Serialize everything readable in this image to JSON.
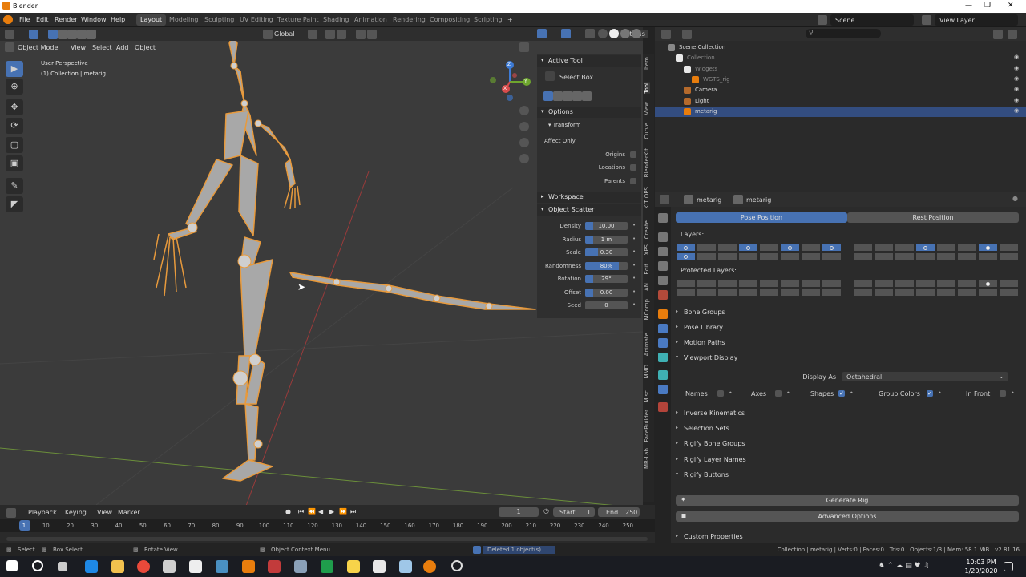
{
  "app": {
    "title": "Blender"
  },
  "menus": [
    "File",
    "Edit",
    "Render",
    "Window",
    "Help"
  ],
  "workspaces": [
    "Layout",
    "Modeling",
    "Sculpting",
    "UV Editing",
    "Texture Paint",
    "Shading",
    "Animation",
    "Rendering",
    "Compositing",
    "Scripting"
  ],
  "active_workspace": "Layout",
  "scene": {
    "name": "Scene",
    "view_layer": "View Layer"
  },
  "viewport": {
    "transform_orientation": "Global",
    "options_label": "Options",
    "mode": "Object Mode",
    "menu": [
      "View",
      "Select",
      "Add",
      "Object"
    ],
    "overlay_line1": "User Perspective",
    "overlay_line2": "(1) Collection | metarig",
    "gizmo_axes": [
      "Z",
      "Y",
      "X"
    ]
  },
  "npanel": {
    "active_tool_header": "Active Tool",
    "active_tool": "Select Box",
    "options_header": "Options",
    "transform_header": "Transform",
    "affect_only": "Affect Only",
    "origins": "Origins",
    "locations": "Locations",
    "parents": "Parents",
    "workspace_header": "Workspace",
    "scatter_header": "Object Scatter",
    "scatter": [
      {
        "label": "Density",
        "value": "10.00",
        "fill": 0.18
      },
      {
        "label": "Radius",
        "value": "1 m",
        "fill": 0.18
      },
      {
        "label": "Scale",
        "value": "0.30",
        "fill": 0.3
      },
      {
        "label": "Randomness",
        "value": "80%",
        "fill": 0.8
      },
      {
        "label": "Rotation",
        "value": "29°",
        "fill": 0.18
      },
      {
        "label": "Offset",
        "value": "0.00",
        "fill": 0.18
      },
      {
        "label": "Seed",
        "value": "0",
        "fill": 0
      }
    ],
    "vertical_tabs": [
      "Item",
      "Tool",
      "View",
      "Curve",
      "BlenderKit",
      "KIT OPS",
      "Create",
      "XPS",
      "Edit",
      "AN",
      "MComp",
      "Animate",
      "MMD",
      "Misc",
      "FaceBuilder",
      "MB-Lab"
    ]
  },
  "outliner": {
    "rows": [
      {
        "label": "Scene Collection",
        "indent": 0
      },
      {
        "label": "Collection",
        "indent": 1
      },
      {
        "label": "Widgets",
        "indent": 2
      },
      {
        "label": "WGTS_rig",
        "indent": 3
      },
      {
        "label": "Camera",
        "indent": 2
      },
      {
        "label": "Light",
        "indent": 2
      },
      {
        "label": "metarig",
        "indent": 2
      }
    ]
  },
  "properties": {
    "breadcrumb1": "metarig",
    "breadcrumb2": "metarig",
    "pose_position": "Pose Position",
    "rest_position": "Rest Position",
    "layers_label": "Layers:",
    "protected_label": "Protected Layers:",
    "sections": [
      "Bone Groups",
      "Pose Library",
      "Motion Paths",
      "Viewport Display",
      "Inverse Kinematics",
      "Selection Sets",
      "Rigify Bone Groups",
      "Rigify Layer Names",
      "Rigify Buttons",
      "Custom Properties"
    ],
    "display_as_label": "Display As",
    "display_as_value": "Octahedral",
    "display_checks": [
      {
        "label": "Names",
        "checked": false
      },
      {
        "label": "Axes",
        "checked": false
      },
      {
        "label": "Shapes",
        "checked": true
      },
      {
        "label": "Group Colors",
        "checked": true
      },
      {
        "label": "In Front",
        "checked": false
      }
    ],
    "generate_rig": "Generate Rig",
    "advanced_options": "Advanced Options"
  },
  "timeline": {
    "menu": [
      "Playback",
      "Keying",
      "View",
      "Marker"
    ],
    "current_frame": "1",
    "start_label": "Start",
    "start": "1",
    "end_label": "End",
    "end": "250",
    "ticks": [
      "1",
      "10",
      "20",
      "30",
      "40",
      "50",
      "60",
      "70",
      "80",
      "90",
      "100",
      "110",
      "120",
      "130",
      "140",
      "150",
      "160",
      "170",
      "180",
      "190",
      "200",
      "210",
      "220",
      "230",
      "240",
      "250"
    ]
  },
  "status": {
    "select": "Select",
    "box_select": "Box Select",
    "rotate_view": "Rotate View",
    "context_menu": "Object Context Menu",
    "message": "Deleted 1 object(s)",
    "stats": "Collection | metarig | Verts:0 | Faces:0 | Tris:0 | Objects:1/3 | Mem: 58.1 MiB | v2.81.16"
  },
  "taskbar": {
    "time": "10:03 PM",
    "date": "1/20/2020"
  },
  "colors": {
    "accent": "#4772b3",
    "bone": "#e89a3c",
    "bone_fill": "#a8a8a8"
  }
}
